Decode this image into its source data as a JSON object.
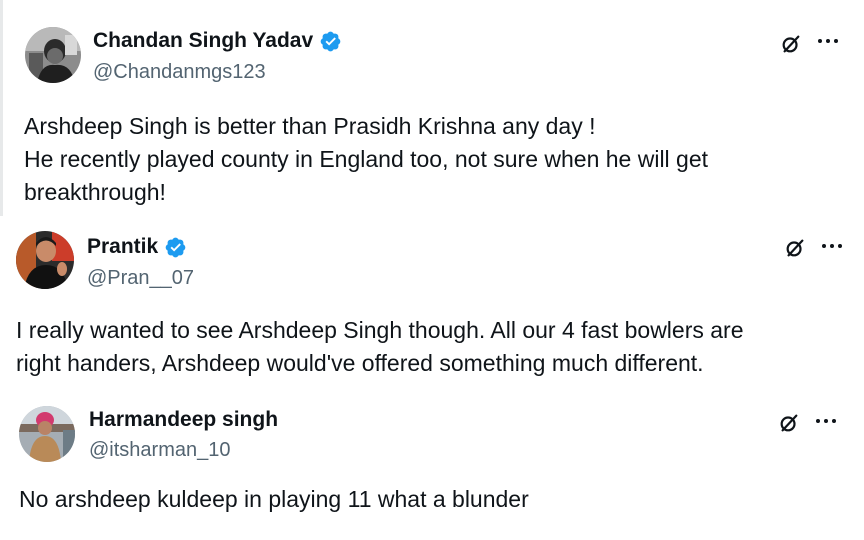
{
  "tweets": [
    {
      "display_name": "Chandan Singh Yadav",
      "handle": "@Chandanmgs123",
      "verified": true,
      "text": "Arshdeep Singh is better than Prasidh Krishna any day !\nHe recently played county in England too, not sure when he will get\nbreakthrough!",
      "icons": [
        "grok-icon",
        "more-options-icon"
      ]
    },
    {
      "display_name": "Prantik",
      "handle": "@Pran__07",
      "verified": true,
      "text": "I really wanted to see Arshdeep Singh though. All our 4 fast bowlers are\nright handers, Arshdeep would've offered something much different.",
      "icons": [
        "grok-icon",
        "more-options-icon"
      ]
    },
    {
      "display_name": "Harmandeep singh",
      "handle": "@itsharman_10",
      "verified": false,
      "text": "No arshdeep kuldeep  in playing 11 what a blunder",
      "icons": [
        "grok-icon",
        "more-options-icon"
      ]
    }
  ],
  "colors": {
    "verified_blue": "#1d9bf0",
    "text_primary": "#0f1419",
    "text_secondary": "#536471"
  }
}
